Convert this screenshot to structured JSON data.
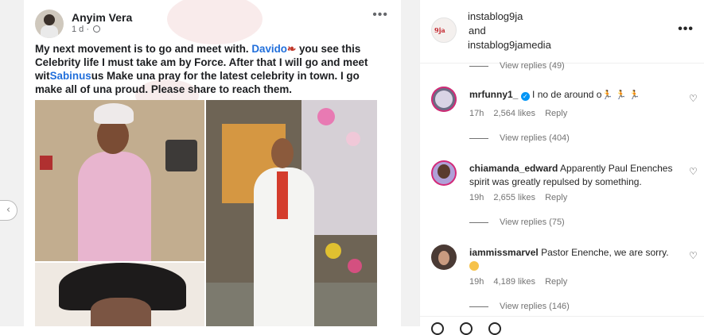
{
  "post": {
    "author": "Anyim Vera",
    "time": "1 d",
    "more": "•••",
    "text_part1": "My next movement is to go and meet with. ",
    "mention1": "Davido",
    "text_part2": " you see this Celebrity life I must take am by Force. After that I will go and meet wit",
    "mention2": "Sabinus",
    "text_part3": "us Make una pray for the latest celebrity in town. I go make all of una proud. Please share to reach them.",
    "nav_prev": "‹"
  },
  "panel": {
    "owner_line1": "instablog9ja",
    "owner_and": "and",
    "owner_line2": "instablog9jamedia",
    "owner_avatar_text": "9ja",
    "more": "•••",
    "view_replies_top": "View replies (49)",
    "comments": [
      {
        "user": "mrfunny1_",
        "verified": true,
        "text": "I no de around o",
        "emoji": "🏃 🏃 🏃",
        "age": "17h",
        "likes": "2,564 likes",
        "reply": "Reply",
        "view_replies": "View replies (404)"
      },
      {
        "user": "chiamanda_edward",
        "text": "Apparently Paul Enenches spirit was greatly repulsed by something.",
        "age": "19h",
        "likes": "2,655 likes",
        "reply": "Reply",
        "view_replies": "View replies (75)"
      },
      {
        "user": "iammissmarvel",
        "text": "Pastor Enenche, we are sorry.",
        "age": "19h",
        "likes": "4,189 likes",
        "reply": "Reply",
        "view_replies": "View replies (146)"
      }
    ],
    "heart": "♡"
  }
}
